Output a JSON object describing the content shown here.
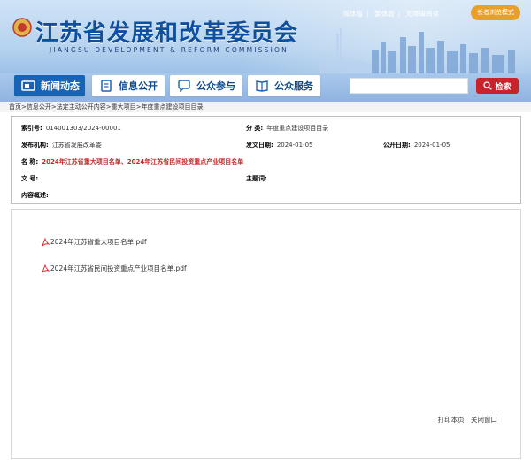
{
  "header": {
    "title": "江苏省发展和改革委员会",
    "subtitle": "JIANGSU DEVELOPMENT & REFORM COMMISSION",
    "toplinks": [
      "简体版",
      "繁体版",
      "无障碍阅读"
    ],
    "care_mode": "长者浏览模式"
  },
  "nav": {
    "items": [
      "新闻动态",
      "信息公开",
      "公众参与",
      "公众服务"
    ],
    "search_placeholder": "",
    "search_button": "检索"
  },
  "breadcrumb": "首页>信息公开>法定主动公开内容>重大项目>年度重点建设项目目录",
  "info": {
    "index_label": "索引号:",
    "index_value": "014001303/2024-00001",
    "category_label": "分  类:",
    "category_value": "年度重点建设项目目录",
    "publisher_label": "发布机构:",
    "publisher_value": "江苏省发展改革委",
    "date_label": "发文日期:",
    "date_value": "2024-01-05",
    "public_date_label": "公开日期:",
    "public_date_value": "2024-01-05",
    "name_label": "名  称:",
    "name_value": "2024年江苏省重大项目名单、2024年江苏省民间投资重点产业项目名单",
    "doc_no_label": "文  号:",
    "doc_no_value": "",
    "keywords_label": "主题词:",
    "keywords_value": "",
    "summary_label": "内容概述:",
    "summary_value": ""
  },
  "files": [
    "2024年江苏省重大项目名单.pdf",
    "2024年江苏省民间投资重点产业项目名单.pdf"
  ],
  "actions": {
    "print": "打印本页",
    "close": "关闭窗口"
  },
  "colors": {
    "brand_blue": "#1763b6",
    "accent_red": "#c9222a",
    "title_red": "#c02a2a",
    "care_orange": "#e8a02b"
  }
}
